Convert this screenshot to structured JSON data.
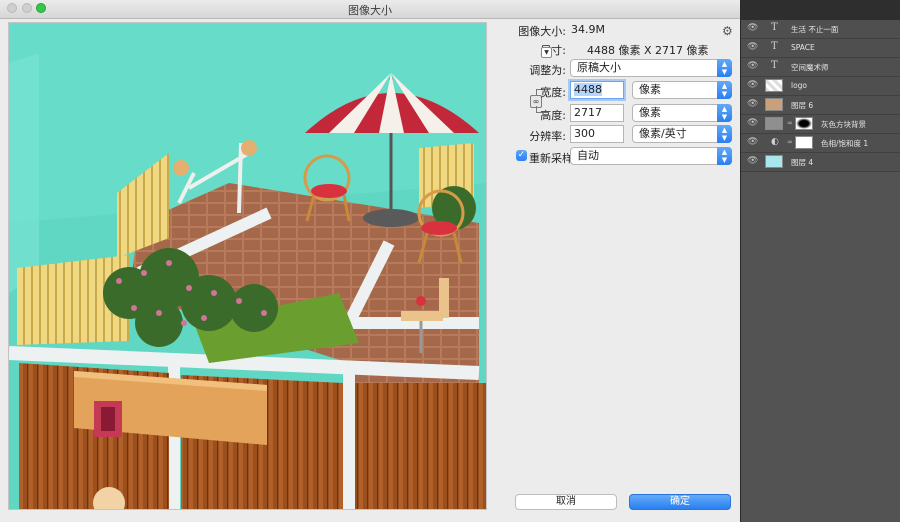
{
  "window": {
    "title": "图像大小"
  },
  "image_size": {
    "label": "图像大小:",
    "value": "34.9M"
  },
  "dimensions": {
    "label": "尺寸:",
    "value": "4488 像素 X 2717 像素"
  },
  "fit_to": {
    "label": "调整为:",
    "value": "原稿大小"
  },
  "width": {
    "label": "宽度:",
    "value": "4488",
    "unit": "像素"
  },
  "height": {
    "label": "高度:",
    "value": "2717",
    "unit": "像素"
  },
  "resolution": {
    "label": "分辨率:",
    "value": "300",
    "unit": "像素/英寸"
  },
  "resample": {
    "label": "重新采样:",
    "checked": true,
    "value": "自动"
  },
  "buttons": {
    "cancel": "取消",
    "ok": "确定"
  },
  "icons": {
    "gear": "gear-icon",
    "lock": "chain-link-icon",
    "eye": "eye-icon",
    "dropdown": "chevron-down-icon"
  },
  "colors": {
    "accent": "#2a7ff0",
    "preview_bg": "#5fd7c3"
  },
  "layers": [
    {
      "kind": "text",
      "name": "生活 不止一面"
    },
    {
      "kind": "text",
      "name": "SPACE"
    },
    {
      "kind": "text",
      "name": "空间魔术师"
    },
    {
      "kind": "image",
      "name": "logo"
    },
    {
      "kind": "image",
      "name": "图层 6"
    },
    {
      "kind": "masked",
      "name": "灰色方块背景"
    },
    {
      "kind": "adjustment",
      "name": "色相/饱和度 1"
    },
    {
      "kind": "fill",
      "name": "图层 4"
    }
  ]
}
